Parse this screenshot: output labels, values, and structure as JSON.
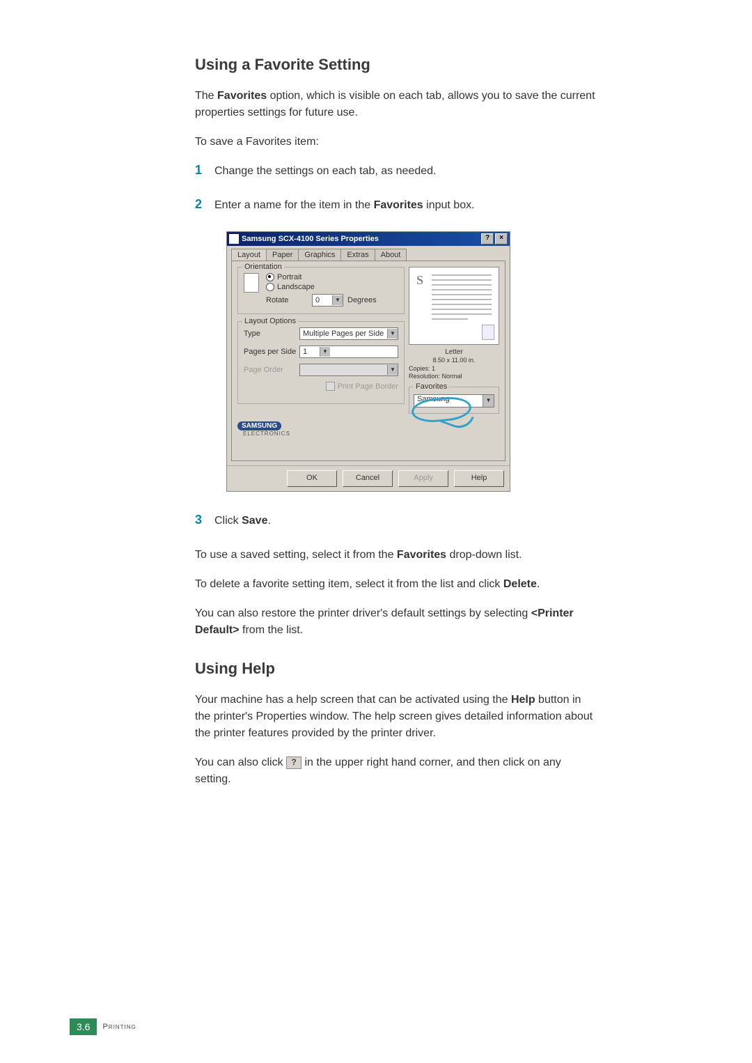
{
  "headings": {
    "h1": "Using a Favorite Setting",
    "h2": "Using Help"
  },
  "paragraphs": {
    "p1a": "The ",
    "p1b": "Favorites",
    "p1c": " option, which is visible on each tab, allows you to save the current properties settings for future use.",
    "p2": "To save a Favorites item:",
    "s1": "Change the settings on each tab, as needed.",
    "s2a": "Enter a name for the item in the ",
    "s2b": "Favorites",
    "s2c": " input box.",
    "s3a": "Click ",
    "s3b": "Save",
    "s3c": ".",
    "p3a": "To use a saved setting, select it from the ",
    "p3b": "Favorites",
    "p3c": " drop-down list.",
    "p4a": "To delete a favorite setting item, select it from the list and click ",
    "p4b": "Delete",
    "p4c": ".",
    "p5a": "You can also restore the printer driver's default settings by selecting ",
    "p5b": "<Printer Default>",
    "p5c": " from the list.",
    "p6a": "Your machine has a help screen that can be activated using the ",
    "p6b": "Help",
    "p6c": " button in the printer's Properties window. The help screen gives detailed information about the printer features provided by the printer driver.",
    "p7a": "You can also click ",
    "p7b": " in the upper right hand corner, and then click on any setting."
  },
  "step_nums": {
    "n1": "1",
    "n2": "2",
    "n3": "3"
  },
  "dialog": {
    "title": "Samsung SCX-4100 Series Properties",
    "help_btn": "?",
    "close_btn": "×",
    "tabs": [
      "Layout",
      "Paper",
      "Graphics",
      "Extras",
      "About"
    ],
    "orientation": {
      "legend": "Orientation",
      "portrait": "Portrait",
      "landscape": "Landscape",
      "rotate": "Rotate",
      "rotate_val": "0",
      "degrees": "Degrees"
    },
    "layout_options": {
      "legend": "Layout Options",
      "type_lbl": "Type",
      "type_val": "Multiple Pages per Side",
      "pps_lbl": "Pages per Side",
      "pps_val": "1",
      "order_lbl": "Page Order",
      "order_val": "",
      "border": "Print Page Border"
    },
    "preview": {
      "letter": "S",
      "paper": "Letter",
      "size": "8.50 x 11.00 in.",
      "copies": "Copies: 1",
      "res": "Resolution: Normal"
    },
    "favorites": {
      "legend": "Favorites",
      "value": "Samsung"
    },
    "brand": {
      "logo": "SAMSUNG",
      "sub": "ELECTRONICS"
    },
    "buttons": {
      "ok": "OK",
      "cancel": "Cancel",
      "apply": "Apply",
      "help": "Help"
    }
  },
  "inline_q": "?",
  "footer": {
    "page": "3.6",
    "section": "Printing"
  }
}
